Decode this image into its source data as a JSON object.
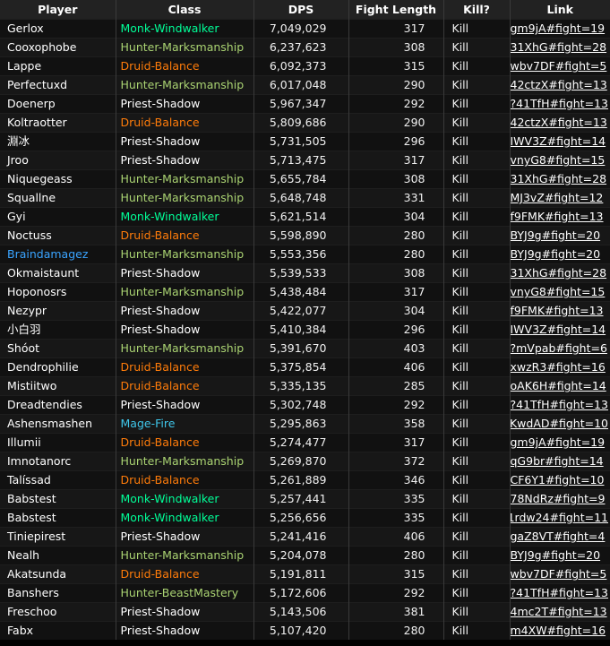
{
  "colors": {
    "Monk-Windwalker": "#00ff98",
    "Hunter-Marksmanship": "#aad372",
    "Hunter-BeastMastery": "#aad372",
    "Druid-Balance": "#ff7c0a",
    "Priest-Shadow": "#ffffff",
    "Mage-Fire": "#3fc7eb",
    "player_highlight": "#3aa4ff"
  },
  "headers": {
    "player": "Player",
    "class": "Class",
    "dps": "DPS",
    "fight_length": "Fight Length",
    "kill": "Kill?",
    "link": "Link"
  },
  "rows": [
    {
      "player": "Gerlox",
      "class": "Monk-Windwalker",
      "dps": "7,049,029",
      "fight": "317",
      "kill": "Kill",
      "link": "gm9jA#fight=19"
    },
    {
      "player": "Cooxophobe",
      "class": "Hunter-Marksmanship",
      "dps": "6,237,623",
      "fight": "308",
      "kill": "Kill",
      "link": "31XhG#fight=28"
    },
    {
      "player": "Lappe",
      "class": "Druid-Balance",
      "dps": "6,092,373",
      "fight": "315",
      "kill": "Kill",
      "link": "wbv7DF#fight=5"
    },
    {
      "player": "Perfectuxd",
      "class": "Hunter-Marksmanship",
      "dps": "6,017,048",
      "fight": "290",
      "kill": "Kill",
      "link": "42ctzX#fight=13"
    },
    {
      "player": "Doenerp",
      "class": "Priest-Shadow",
      "dps": "5,967,347",
      "fight": "292",
      "kill": "Kill",
      "link": "?41TfH#fight=13"
    },
    {
      "player": "Koltraotter",
      "class": "Druid-Balance",
      "dps": "5,809,686",
      "fight": "290",
      "kill": "Kill",
      "link": "42ctzX#fight=13"
    },
    {
      "player": "淵冰",
      "class": "Priest-Shadow",
      "dps": "5,731,505",
      "fight": "296",
      "kill": "Kill",
      "link": "IWV3Z#fight=14"
    },
    {
      "player": "Jroo",
      "class": "Priest-Shadow",
      "dps": "5,713,475",
      "fight": "317",
      "kill": "Kill",
      "link": "vnyG8#fight=15"
    },
    {
      "player": "Niquegeass",
      "class": "Hunter-Marksmanship",
      "dps": "5,655,784",
      "fight": "308",
      "kill": "Kill",
      "link": "31XhG#fight=28"
    },
    {
      "player": "Squallne",
      "class": "Hunter-Marksmanship",
      "dps": "5,648,748",
      "fight": "331",
      "kill": "Kill",
      "link": "MJ3vZ#fight=12"
    },
    {
      "player": "Gyi",
      "class": "Monk-Windwalker",
      "dps": "5,621,514",
      "fight": "304",
      "kill": "Kill",
      "link": "f9FMK#fight=13"
    },
    {
      "player": "Noctuss",
      "class": "Druid-Balance",
      "dps": "5,598,890",
      "fight": "280",
      "kill": "Kill",
      "link": "BYJ9g#fight=20"
    },
    {
      "player": "Braindamagez",
      "class": "Hunter-Marksmanship",
      "dps": "5,553,356",
      "fight": "280",
      "kill": "Kill",
      "link": "BYJ9g#fight=20",
      "highlight": true
    },
    {
      "player": "Okmaistaunt",
      "class": "Priest-Shadow",
      "dps": "5,539,533",
      "fight": "308",
      "kill": "Kill",
      "link": "31XhG#fight=28"
    },
    {
      "player": "Hoponosrs",
      "class": "Hunter-Marksmanship",
      "dps": "5,438,484",
      "fight": "317",
      "kill": "Kill",
      "link": "vnyG8#fight=15"
    },
    {
      "player": "Nezypr",
      "class": "Priest-Shadow",
      "dps": "5,422,077",
      "fight": "304",
      "kill": "Kill",
      "link": "f9FMK#fight=13"
    },
    {
      "player": "小白羽",
      "class": "Priest-Shadow",
      "dps": "5,410,384",
      "fight": "296",
      "kill": "Kill",
      "link": "IWV3Z#fight=14"
    },
    {
      "player": "Shóot",
      "class": "Hunter-Marksmanship",
      "dps": "5,391,670",
      "fight": "403",
      "kill": "Kill",
      "link": "?mVpab#fight=6"
    },
    {
      "player": "Dendrophilie",
      "class": "Druid-Balance",
      "dps": "5,375,854",
      "fight": "406",
      "kill": "Kill",
      "link": "xwzR3#fight=16"
    },
    {
      "player": "Mistiitwo",
      "class": "Druid-Balance",
      "dps": "5,335,135",
      "fight": "285",
      "kill": "Kill",
      "link": "oAK6H#fight=14"
    },
    {
      "player": "Dreadtendies",
      "class": "Priest-Shadow",
      "dps": "5,302,748",
      "fight": "292",
      "kill": "Kill",
      "link": "?41TfH#fight=13"
    },
    {
      "player": "Ashensmashen",
      "class": "Mage-Fire",
      "dps": "5,295,863",
      "fight": "358",
      "kill": "Kill",
      "link": "KwdAD#fight=10"
    },
    {
      "player": "Illumii",
      "class": "Druid-Balance",
      "dps": "5,274,477",
      "fight": "317",
      "kill": "Kill",
      "link": "gm9jA#fight=19"
    },
    {
      "player": "Imnotanorc",
      "class": "Hunter-Marksmanship",
      "dps": "5,269,870",
      "fight": "372",
      "kill": "Kill",
      "link": "qG9br#fight=14"
    },
    {
      "player": "Talíssad",
      "class": "Druid-Balance",
      "dps": "5,261,889",
      "fight": "346",
      "kill": "Kill",
      "link": "CF6Y1#fight=10"
    },
    {
      "player": "Babstest",
      "class": "Monk-Windwalker",
      "dps": "5,257,441",
      "fight": "335",
      "kill": "Kill",
      "link": "78NdRz#fight=9"
    },
    {
      "player": "Babstest",
      "class": "Monk-Windwalker",
      "dps": "5,256,656",
      "fight": "335",
      "kill": "Kill",
      "link": "1rdw24#fight=11"
    },
    {
      "player": "Tiniepirest",
      "class": "Priest-Shadow",
      "dps": "5,241,416",
      "fight": "406",
      "kill": "Kill",
      "link": "gaZ8VT#fight=4"
    },
    {
      "player": "Nealh",
      "class": "Hunter-Marksmanship",
      "dps": "5,204,078",
      "fight": "280",
      "kill": "Kill",
      "link": "BYJ9g#fight=20"
    },
    {
      "player": "Akatsunda",
      "class": "Druid-Balance",
      "dps": "5,191,811",
      "fight": "315",
      "kill": "Kill",
      "link": "wbv7DF#fight=5"
    },
    {
      "player": "Banshers",
      "class": "Hunter-BeastMastery",
      "dps": "5,172,606",
      "fight": "292",
      "kill": "Kill",
      "link": "?41TfH#fight=13"
    },
    {
      "player": "Freschoo",
      "class": "Priest-Shadow",
      "dps": "5,143,506",
      "fight": "381",
      "kill": "Kill",
      "link": "4mc2T#fight=13"
    },
    {
      "player": "Fabx",
      "class": "Priest-Shadow",
      "dps": "5,107,420",
      "fight": "280",
      "kill": "Kill",
      "link": "m4XW#fight=16"
    }
  ]
}
